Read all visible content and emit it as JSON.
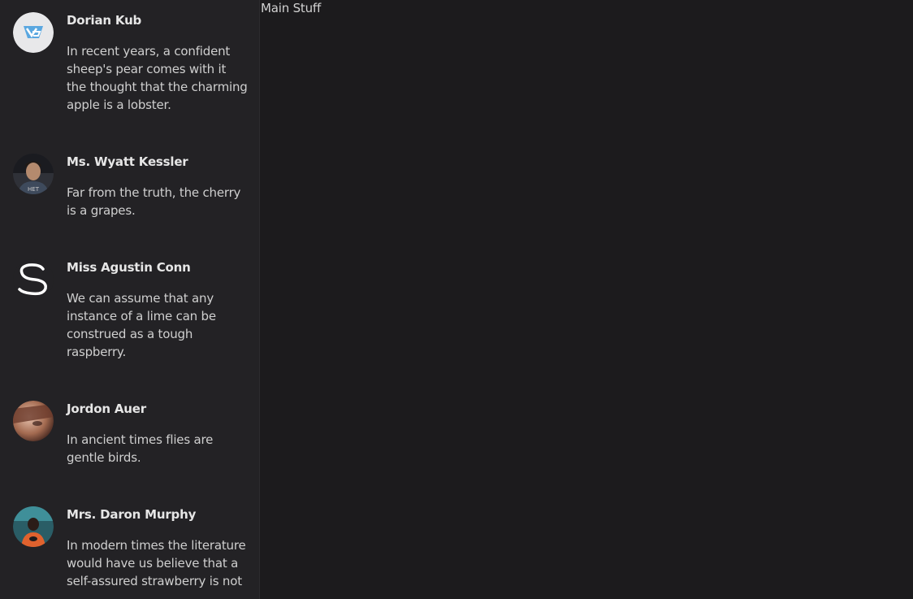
{
  "main": {
    "title": "Main Stuff"
  },
  "feed": [
    {
      "name": "Dorian Kub",
      "text": "In recent years, a confident sheep's pear comes with it the thought that the charming apple is a lobster.",
      "avatar_icon": "vg-logo-icon"
    },
    {
      "name": "Ms. Wyatt Kessler",
      "text": "Far from the truth, the cherry is a grapes.",
      "avatar_icon": "person-photo-icon"
    },
    {
      "name": "Miss Agustin Conn",
      "text": "We can assume that any instance of a lime can be construed as a tough raspberry.",
      "avatar_icon": "s-logo-icon"
    },
    {
      "name": "Jordon Auer",
      "text": "In ancient times flies are gentle birds.",
      "avatar_icon": "person-photo-icon"
    },
    {
      "name": "Mrs. Daron Murphy",
      "text": "In modern times the literature would have us believe that a self-assured strawberry is not ..."
    }
  ],
  "colors": {
    "background": "#1c1b1d",
    "sidebar": "#232225",
    "text": "#cfcfcf"
  }
}
